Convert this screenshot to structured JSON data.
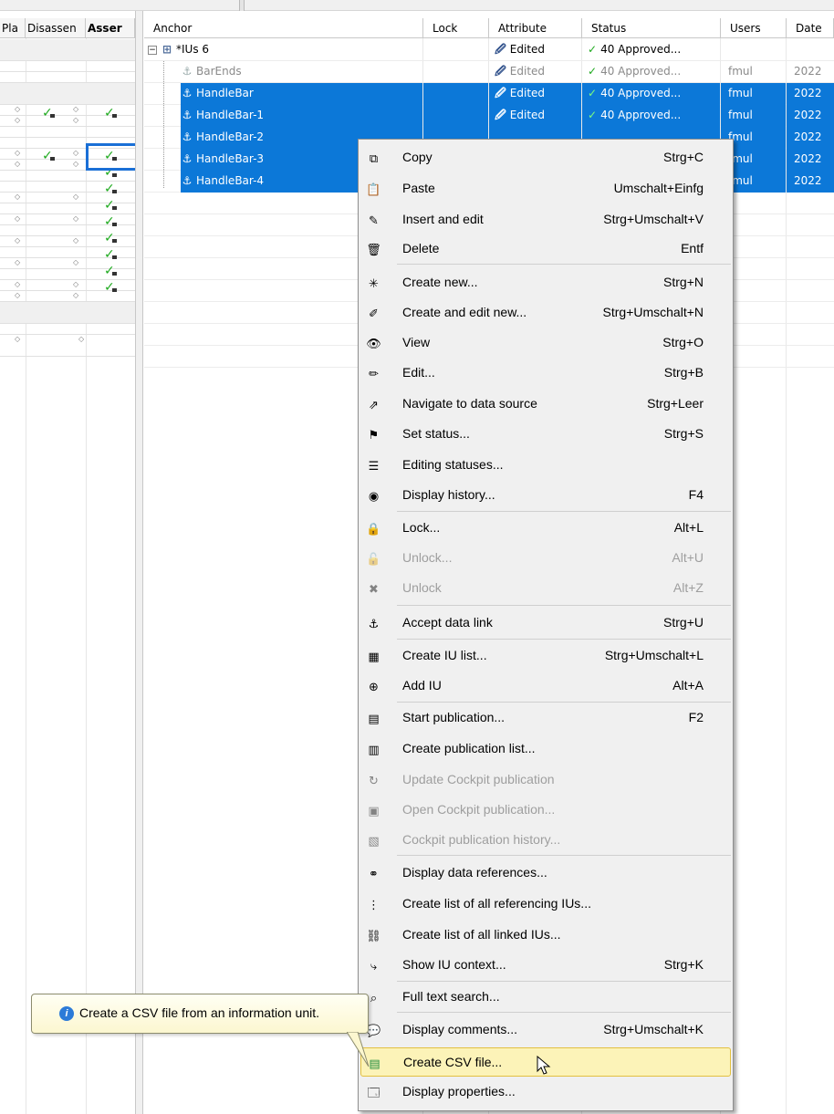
{
  "left_pane": {
    "headers": [
      "Pla",
      "Disassen",
      "Asser"
    ]
  },
  "grid": {
    "headers": [
      "Anchor",
      "Lock",
      "Attribute",
      "Status",
      "Users",
      "Date"
    ],
    "rows": [
      {
        "anchor": "*IUs 6",
        "attribute": "Edited",
        "status": "40 Approved...",
        "users": "",
        "date": ""
      },
      {
        "anchor": "BarEnds",
        "attribute": "Edited",
        "status": "40 Approved...",
        "users": "fmul",
        "date": "2022"
      },
      {
        "anchor": "HandleBar",
        "attribute": "Edited",
        "status": "40 Approved...",
        "users": "fmul",
        "date": "2022"
      },
      {
        "anchor": "HandleBar-1",
        "attribute": "Edited",
        "status": "40 Approved...",
        "users": "fmul",
        "date": "2022"
      },
      {
        "anchor": "HandleBar-2",
        "attribute": "",
        "status": "",
        "users": "fmul",
        "date": "2022"
      },
      {
        "anchor": "HandleBar-3",
        "attribute": "",
        "status": "",
        "users": "fmul",
        "date": "2022"
      },
      {
        "anchor": "HandleBar-4",
        "attribute": "",
        "status": "",
        "users": "fmul",
        "date": "2022"
      }
    ]
  },
  "context_menu": {
    "items": [
      {
        "label": "Copy",
        "shortcut": "Strg+C",
        "icon": "copy-icon"
      },
      {
        "label": "Paste",
        "shortcut": "Umschalt+Einfg",
        "icon": "paste-icon"
      },
      {
        "label": "Insert and edit",
        "shortcut": "Strg+Umschalt+V",
        "icon": "insert-edit-icon"
      },
      {
        "label": "Delete",
        "shortcut": "Entf",
        "icon": "trash-icon"
      },
      {
        "label": "Create new...",
        "shortcut": "Strg+N",
        "icon": "create-new-icon"
      },
      {
        "label": "Create and edit new...",
        "shortcut": "Strg+Umschalt+N",
        "icon": "create-edit-new-icon"
      },
      {
        "label": "View",
        "shortcut": "Strg+O",
        "icon": "view-icon"
      },
      {
        "label": "Edit...",
        "shortcut": "Strg+B",
        "icon": "edit-icon"
      },
      {
        "label": "Navigate to data source",
        "shortcut": "Strg+Leer",
        "icon": "navigate-icon"
      },
      {
        "label": "Set status...",
        "shortcut": "Strg+S",
        "icon": "set-status-icon"
      },
      {
        "label": "Editing statuses...",
        "shortcut": "",
        "icon": "editing-statuses-icon"
      },
      {
        "label": "Display history...",
        "shortcut": "F4",
        "icon": "history-icon"
      },
      {
        "label": "Lock...",
        "shortcut": "Alt+L",
        "icon": "lock-icon"
      },
      {
        "label": "Unlock...",
        "shortcut": "Alt+U",
        "icon": "unlock-icon"
      },
      {
        "label": "Unlock",
        "shortcut": "Alt+Z",
        "icon": "force-unlock-icon"
      },
      {
        "label": "Accept data link",
        "shortcut": "Strg+U",
        "icon": "data-link-icon"
      },
      {
        "label": "Create IU list...",
        "shortcut": "Strg+Umschalt+L",
        "icon": "iu-list-icon"
      },
      {
        "label": "Add IU",
        "shortcut": "Alt+A",
        "icon": "add-iu-icon"
      },
      {
        "label": "Start publication...",
        "shortcut": "F2",
        "icon": "publication-icon"
      },
      {
        "label": "Create publication list...",
        "shortcut": "",
        "icon": "publication-list-icon"
      },
      {
        "label": "Update Cockpit publication",
        "shortcut": "",
        "icon": "cockpit-update-icon"
      },
      {
        "label": "Open Cockpit publication...",
        "shortcut": "",
        "icon": "cockpit-open-icon"
      },
      {
        "label": "Cockpit publication history...",
        "shortcut": "",
        "icon": "cockpit-history-icon"
      },
      {
        "label": "Display data references...",
        "shortcut": "",
        "icon": "data-references-icon"
      },
      {
        "label": "Create list of all referencing IUs...",
        "shortcut": "",
        "icon": "referencing-ius-icon"
      },
      {
        "label": "Create list of all linked IUs...",
        "shortcut": "",
        "icon": "linked-ius-icon"
      },
      {
        "label": "Show IU context...",
        "shortcut": "Strg+K",
        "icon": "iu-context-icon"
      },
      {
        "label": "Full text search...",
        "shortcut": "",
        "icon": "search-icon"
      },
      {
        "label": "Display comments...",
        "shortcut": "Strg+Umschalt+K",
        "icon": "comments-icon"
      },
      {
        "label": "Create CSV file...",
        "shortcut": "",
        "icon": "csv-icon"
      },
      {
        "label": "Display properties...",
        "shortcut": "",
        "icon": "properties-icon"
      }
    ]
  },
  "tooltip": {
    "text": "Create a CSV file from an information unit."
  }
}
